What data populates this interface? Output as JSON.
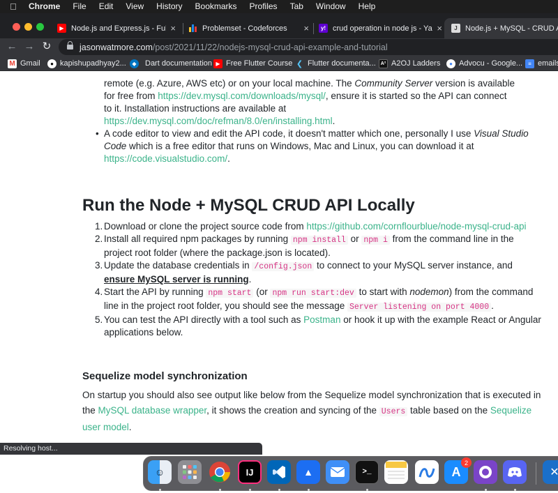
{
  "menubar": {
    "apple_icon": "apple-icon",
    "app_name": "Chrome",
    "items": [
      "File",
      "Edit",
      "View",
      "History",
      "Bookmarks",
      "Profiles",
      "Tab",
      "Window",
      "Help"
    ]
  },
  "tabs": [
    {
      "title": "Node.js and Express.js - Full C",
      "favicon": "youtube-icon",
      "active": false
    },
    {
      "title": "Problemset - Codeforces",
      "favicon": "codeforces-icon",
      "active": false
    },
    {
      "title": "crud operation in node js - Yah",
      "favicon": "yahoo-icon",
      "active": false
    },
    {
      "title": "Node.js + MySQL - CRUD API E",
      "favicon": "jasonwatmore-icon",
      "active": true
    }
  ],
  "tab_close": "×",
  "toolbar": {
    "back": "←",
    "forward": "→",
    "reload": "↻",
    "url_host": "jasonwatmore.com",
    "url_path": "/post/2021/11/22/nodejs-mysql-crud-api-example-and-tutorial"
  },
  "bookmarks": [
    {
      "label": "Gmail",
      "icon": "gmail-icon"
    },
    {
      "label": "kapishupadhyay2...",
      "icon": "github-icon"
    },
    {
      "label": "Dart documentation",
      "icon": "dart-icon"
    },
    {
      "label": "Free Flutter Course",
      "icon": "youtube-icon"
    },
    {
      "label": "Flutter documenta...",
      "icon": "flutter-icon"
    },
    {
      "label": "A2OJ Ladders",
      "icon": "a2oj-icon"
    },
    {
      "label": "Advocu - Google...",
      "icon": "advocu-icon"
    },
    {
      "label": "emails",
      "icon": "docs-icon"
    }
  ],
  "content": {
    "top_frag1": "remote (e.g. Azure, AWS etc) or on your local machine. The ",
    "top_em": "Community Server",
    "top_frag2": " version is available",
    "top_line2a": "for free from ",
    "top_link1": "https://dev.mysql.com/downloads/mysql/",
    "top_line2b": ", ensure it is started so the API can connect",
    "top_line3": "to it. Installation instructions are available at",
    "top_link2": "https://dev.mysql.com/doc/refman/8.0/en/installing.html",
    "top_line4": ".",
    "bullet_a": "A code editor to view and edit the API code, it doesn't matter which one, personally I use ",
    "bullet_em": "Visual Studio Code",
    "bullet_b": " which is a free editor that runs on Windows, Mac and Linux, you can download it at ",
    "bullet_link": "https://code.visualstudio.com/",
    "bullet_end": ".",
    "section_title": "Run the Node + MySQL CRUD API Locally",
    "step1_a": "Download or clone the project source code from ",
    "step1_link": "https://github.com/cornflourblue/node-mysql-crud-api",
    "step2_a": "Install all required npm packages by running ",
    "step2_code1": "npm install",
    "step2_or": " or ",
    "step2_code2": "npm i",
    "step2_b": " from the command line in the project root folder (where the package.json is located).",
    "step3_a": "Update the database credentials in ",
    "step3_code": "/config.json",
    "step3_b": " to connect to your MySQL server instance, and ",
    "step3_strong": "ensure MySQL server is running",
    "step3_end": ".",
    "step4_a": "Start the API by running ",
    "step4_code1": "npm start",
    "step4_b": " (or ",
    "step4_code2": "npm run start:dev",
    "step4_c": " to start with ",
    "step4_em": "nodemon",
    "step4_d": ") from the command line in the project root folder, you should see the message ",
    "step4_code3": "Server listening on port 4000",
    "step4_end": ".",
    "step5_a": "You can test the API directly with a tool such as ",
    "step5_link": "Postman",
    "step5_b": " or hook it up with the example React or Angular applications below.",
    "sub_title": "Sequelize model synchronization",
    "para_a": "On startup you should also see output like below from the Sequelize model synchronization that is executed in the ",
    "para_link1": "MySQL database wrapper",
    "para_b": ", it shows the creation and syncing of the ",
    "para_code": "Users",
    "para_c": " table based on the ",
    "para_link2": "Sequelize user model",
    "para_end": "."
  },
  "status": "Resolving host...",
  "dock": {
    "apps": [
      "finder-icon",
      "launchpad-icon",
      "chrome-icon",
      "intellij-icon",
      "vscode-icon",
      "xcode-icon",
      "mail-icon",
      "terminal-icon",
      "notes-icon",
      "freeform-icon",
      "app-store-icon",
      "github-desktop-icon",
      "discord-icon",
      "close-app-icon"
    ],
    "app_store_badge": "2",
    "intellij_label": "IJ"
  },
  "colors": {
    "link": "#3bb38a",
    "code": "#d63384",
    "menubar": "#1e1e1e",
    "tabstrip": "#202124",
    "toolbar": "#35363a"
  }
}
